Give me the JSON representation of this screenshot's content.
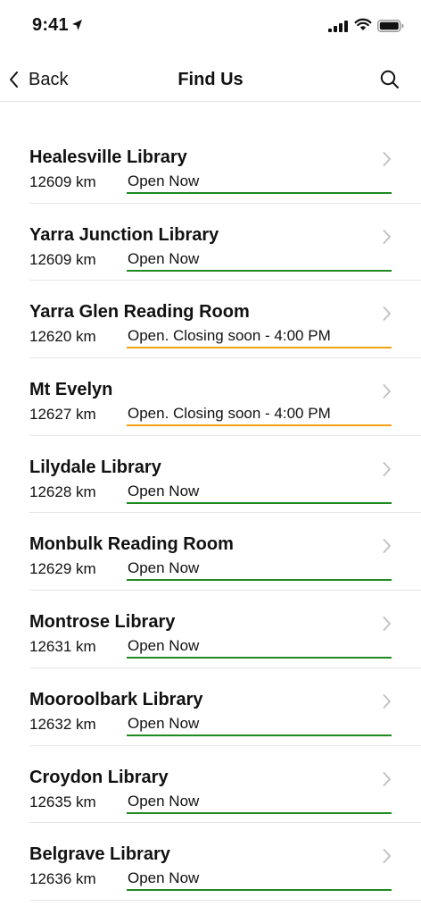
{
  "status_bar": {
    "time": "9:41",
    "icons": [
      "location-arrow-icon",
      "cellular-signal-icon",
      "wifi-icon",
      "battery-icon"
    ]
  },
  "nav": {
    "back_label": "Back",
    "title": "Find Us",
    "search_icon": "search-icon"
  },
  "colors": {
    "open": "#1f8a1f",
    "closing_soon": "#f0a010"
  },
  "libraries": [
    {
      "name": "Healesville Library",
      "distance": "12609 km",
      "status": "Open Now",
      "state": "open"
    },
    {
      "name": "Yarra Junction Library",
      "distance": "12609 km",
      "status": "Open Now",
      "state": "open"
    },
    {
      "name": "Yarra Glen Reading Room",
      "distance": "12620 km",
      "status": "Open. Closing soon - 4:00 PM",
      "state": "soon"
    },
    {
      "name": "Mt Evelyn",
      "distance": "12627 km",
      "status": "Open. Closing soon - 4:00 PM",
      "state": "soon"
    },
    {
      "name": "Lilydale Library",
      "distance": "12628 km",
      "status": "Open Now",
      "state": "open"
    },
    {
      "name": "Monbulk Reading Room",
      "distance": "12629 km",
      "status": "Open Now",
      "state": "open"
    },
    {
      "name": "Montrose Library",
      "distance": "12631 km",
      "status": "Open Now",
      "state": "open"
    },
    {
      "name": "Mooroolbark Library",
      "distance": "12632 km",
      "status": "Open Now",
      "state": "open"
    },
    {
      "name": "Croydon Library",
      "distance": "12635 km",
      "status": "Open Now",
      "state": "open"
    },
    {
      "name": "Belgrave Library",
      "distance": "12636 km",
      "status": "Open Now",
      "state": "open"
    }
  ]
}
